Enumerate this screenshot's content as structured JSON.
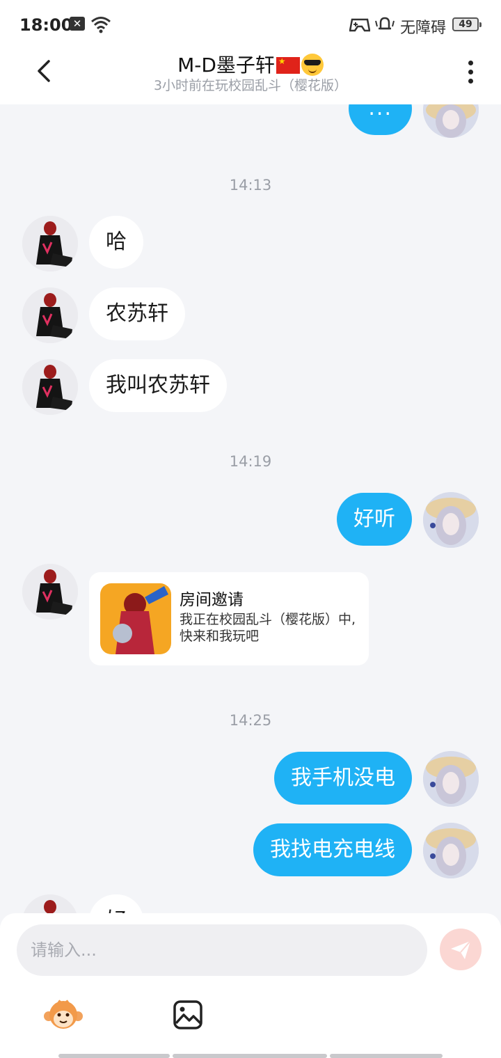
{
  "status_bar": {
    "time": "18:00",
    "accessibility_label": "无障碍",
    "battery": "49"
  },
  "header": {
    "title": "M-D墨子轩",
    "subtitle": "3小时前在玩校园乱斗（樱花版）"
  },
  "messages": {
    "top_partial_bubble": "...",
    "ts1": "14:13",
    "m1": "哈",
    "m2": "农苏轩",
    "m3": "我叫农苏轩",
    "ts2": "14:19",
    "m4": "好听",
    "invite": {
      "title": "房间邀请",
      "description": "我正在校园乱斗（樱花版）中, 快来和我玩吧"
    },
    "ts3": "14:25",
    "m5": "我手机没电",
    "m6": "我找电充电线",
    "m7_partial": "好"
  },
  "input": {
    "placeholder": "请输入..."
  },
  "colors": {
    "accent_bubble": "#1fb2f5",
    "background": "#f4f5f8",
    "send_button": "#fbd7d3"
  },
  "icons": {
    "back": "back-arrow-icon",
    "more": "more-vertical-icon",
    "send": "paper-plane-icon",
    "emoji": "monkey-emoji-icon",
    "image": "image-icon"
  }
}
